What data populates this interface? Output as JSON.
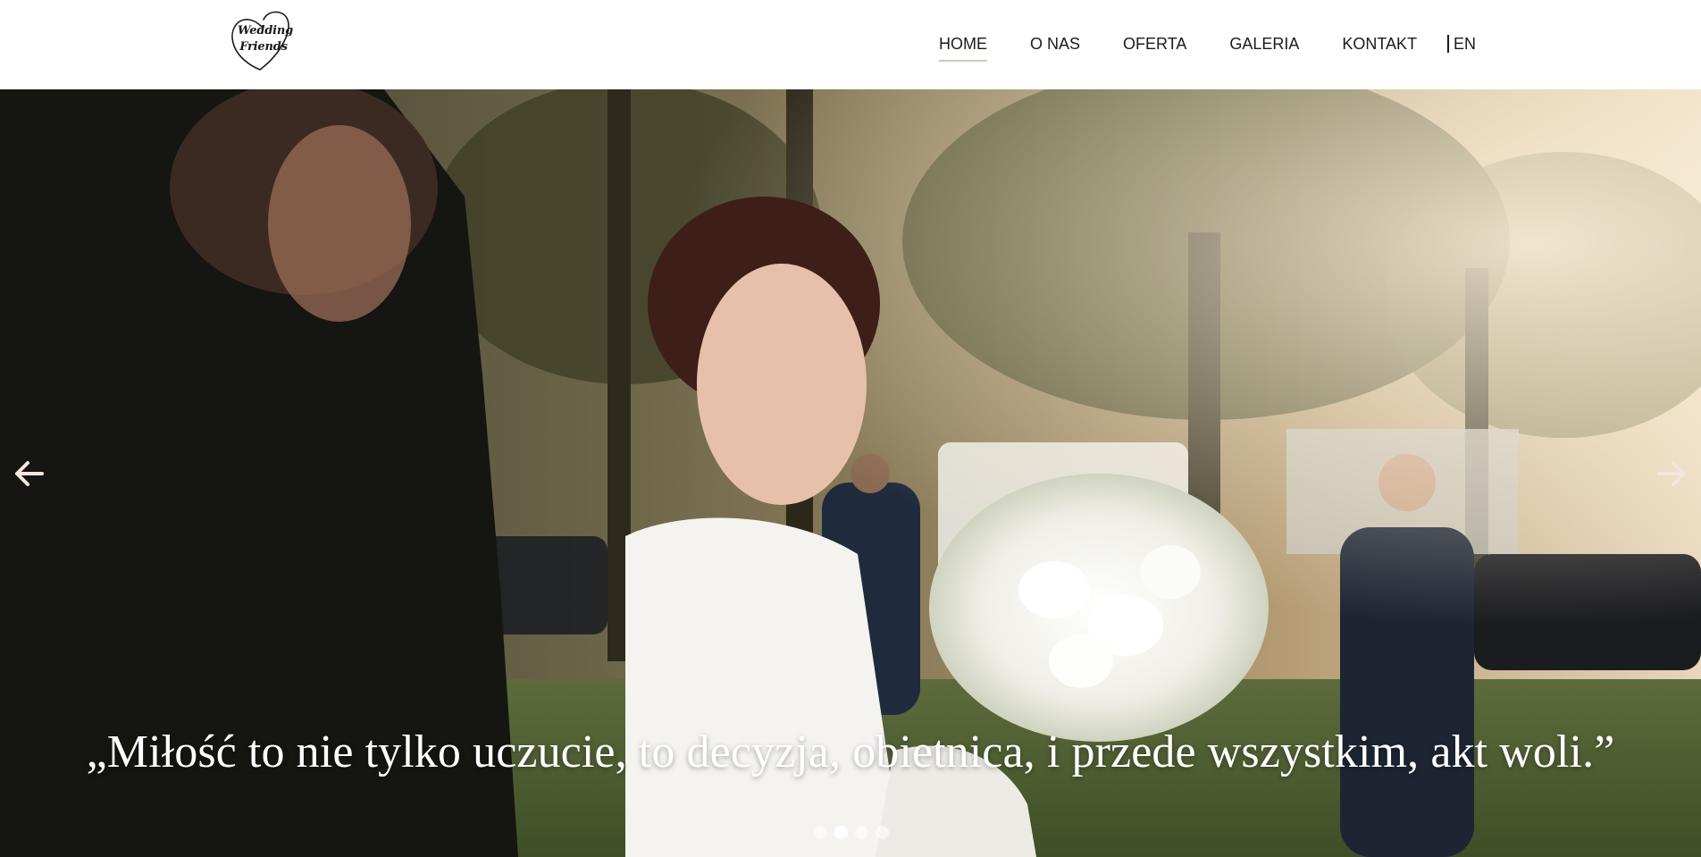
{
  "header": {
    "logo": {
      "line1": "Wedding",
      "line2": "Friends"
    },
    "nav": [
      {
        "label": "HOME",
        "active": true
      },
      {
        "label": "O NAS",
        "active": false
      },
      {
        "label": "OFERTA",
        "active": false
      },
      {
        "label": "GALERIA",
        "active": false
      },
      {
        "label": "KONTAKT",
        "active": false
      }
    ],
    "language": "EN"
  },
  "hero": {
    "quote": "„Miłość to nie tylko uczucie, to decyzja, obietnica, i przede wszystkim, akt woli.”",
    "prev_icon": "arrow-left-icon",
    "next_icon": "arrow-right-icon",
    "slides_total": 4,
    "active_slide": 2
  },
  "colors": {
    "nav_text": "#1b1b1b",
    "active_underline": "#d9c3b6",
    "arrow": "#f3e6dc",
    "quote_text": "#ffffff"
  }
}
